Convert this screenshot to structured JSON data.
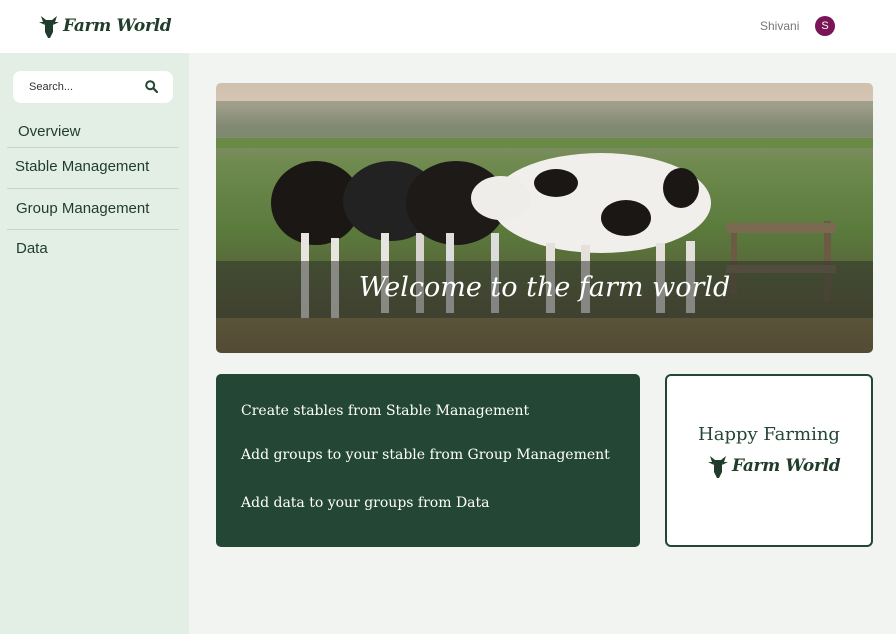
{
  "header": {
    "brand": "Farm World",
    "user_name": "Shivani",
    "avatar_initial": "S"
  },
  "sidebar": {
    "search_placeholder": "Search...",
    "items": [
      {
        "label": "Overview"
      },
      {
        "label": "Stable Management"
      },
      {
        "label": "Group Management"
      },
      {
        "label": "Data"
      }
    ]
  },
  "hero": {
    "title": "Welcome to the farm world"
  },
  "info": {
    "lines": [
      "Create stables from Stable Management",
      "Add groups to your stable from Group Management",
      "Add data to your groups from Data"
    ]
  },
  "card": {
    "title": "Happy Farming",
    "brand": "Farm World"
  },
  "colors": {
    "primary": "#244634",
    "sidebar_bg": "#e3eee4",
    "avatar_bg": "#7a1456"
  }
}
